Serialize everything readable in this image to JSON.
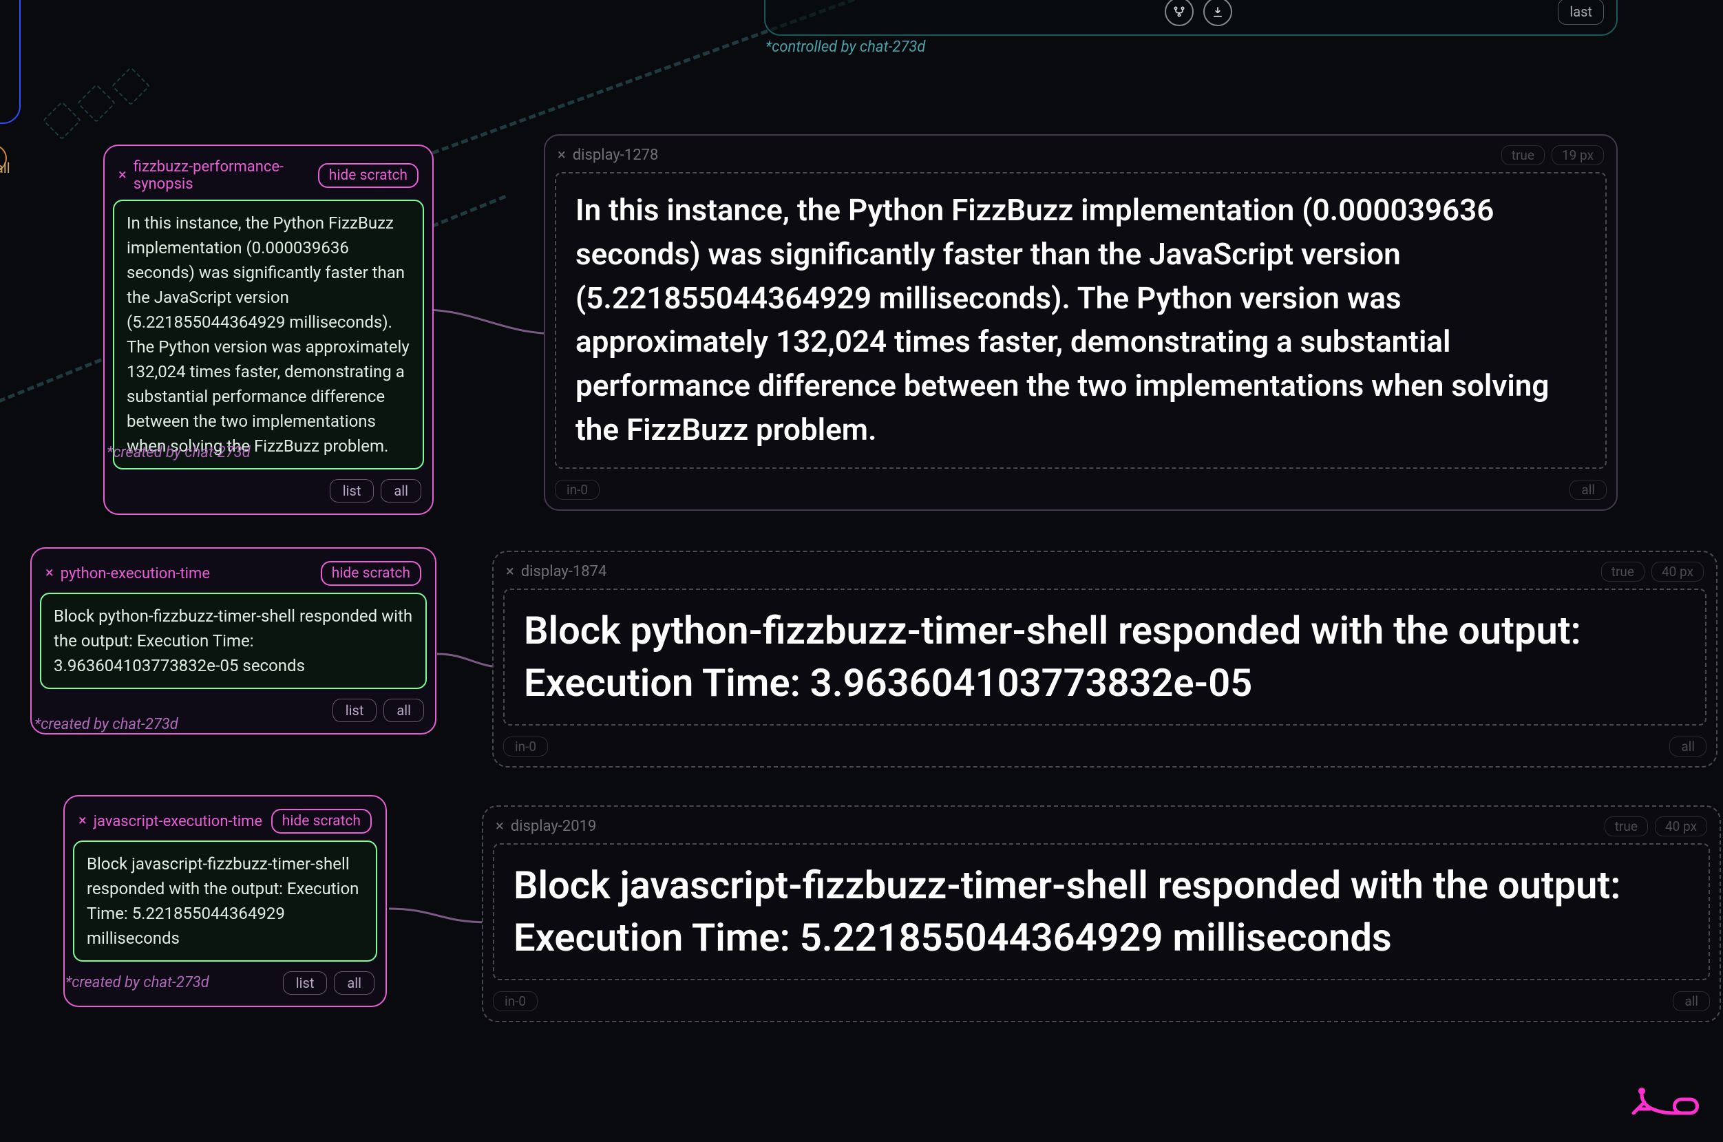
{
  "meta": {
    "controlled_by": "*controlled by chat-273d",
    "created_by": "*created by chat-273d"
  },
  "top_panel": {
    "icon1": "fork-icon",
    "icon2": "download-icon",
    "last": "last"
  },
  "frag": {
    "all": "all"
  },
  "common": {
    "hide": "hide scratch",
    "list": "list",
    "all": "all",
    "in0": "in-0",
    "true": "true"
  },
  "scratch": [
    {
      "title": "fizzbuzz-performance-synopsis",
      "body": "In this instance, the Python FizzBuzz implementation (0.000039636 seconds) was significantly faster than the JavaScript version (5.221855044364929 milliseconds). The Python version was approximately 132,024 times faster, demonstrating a substantial performance difference between the two implementations when solving the FizzBuzz problem."
    },
    {
      "title": "python-execution-time",
      "body": "Block python-fizzbuzz-timer-shell responded with the output: Execution Time: 3.963604103773832e-05 seconds"
    },
    {
      "title": "javascript-execution-time",
      "body": "Block javascript-fizzbuzz-timer-shell responded with the output: Execution Time: 5.221855044364929 milliseconds"
    }
  ],
  "display": [
    {
      "id": "display-1278",
      "px": "19 px",
      "body": "In this instance, the Python FizzBuzz implementation (0.000039636 seconds) was significantly faster than the JavaScript version (5.221855044364929 milliseconds). The Python version was approximately 132,024 times faster, demonstrating a substantial performance difference between the two implementations when solving the FizzBuzz problem."
    },
    {
      "id": "display-1874",
      "px": "40 px",
      "body": "Block python-fizzbuzz-timer-shell responded with the output: Execution Time: 3.963604103773832e-05"
    },
    {
      "id": "display-2019",
      "px": "40 px",
      "body": "Block javascript-fizzbuzz-timer-shell responded with the output: Execution Time: 5.221855044364929 milliseconds"
    }
  ]
}
